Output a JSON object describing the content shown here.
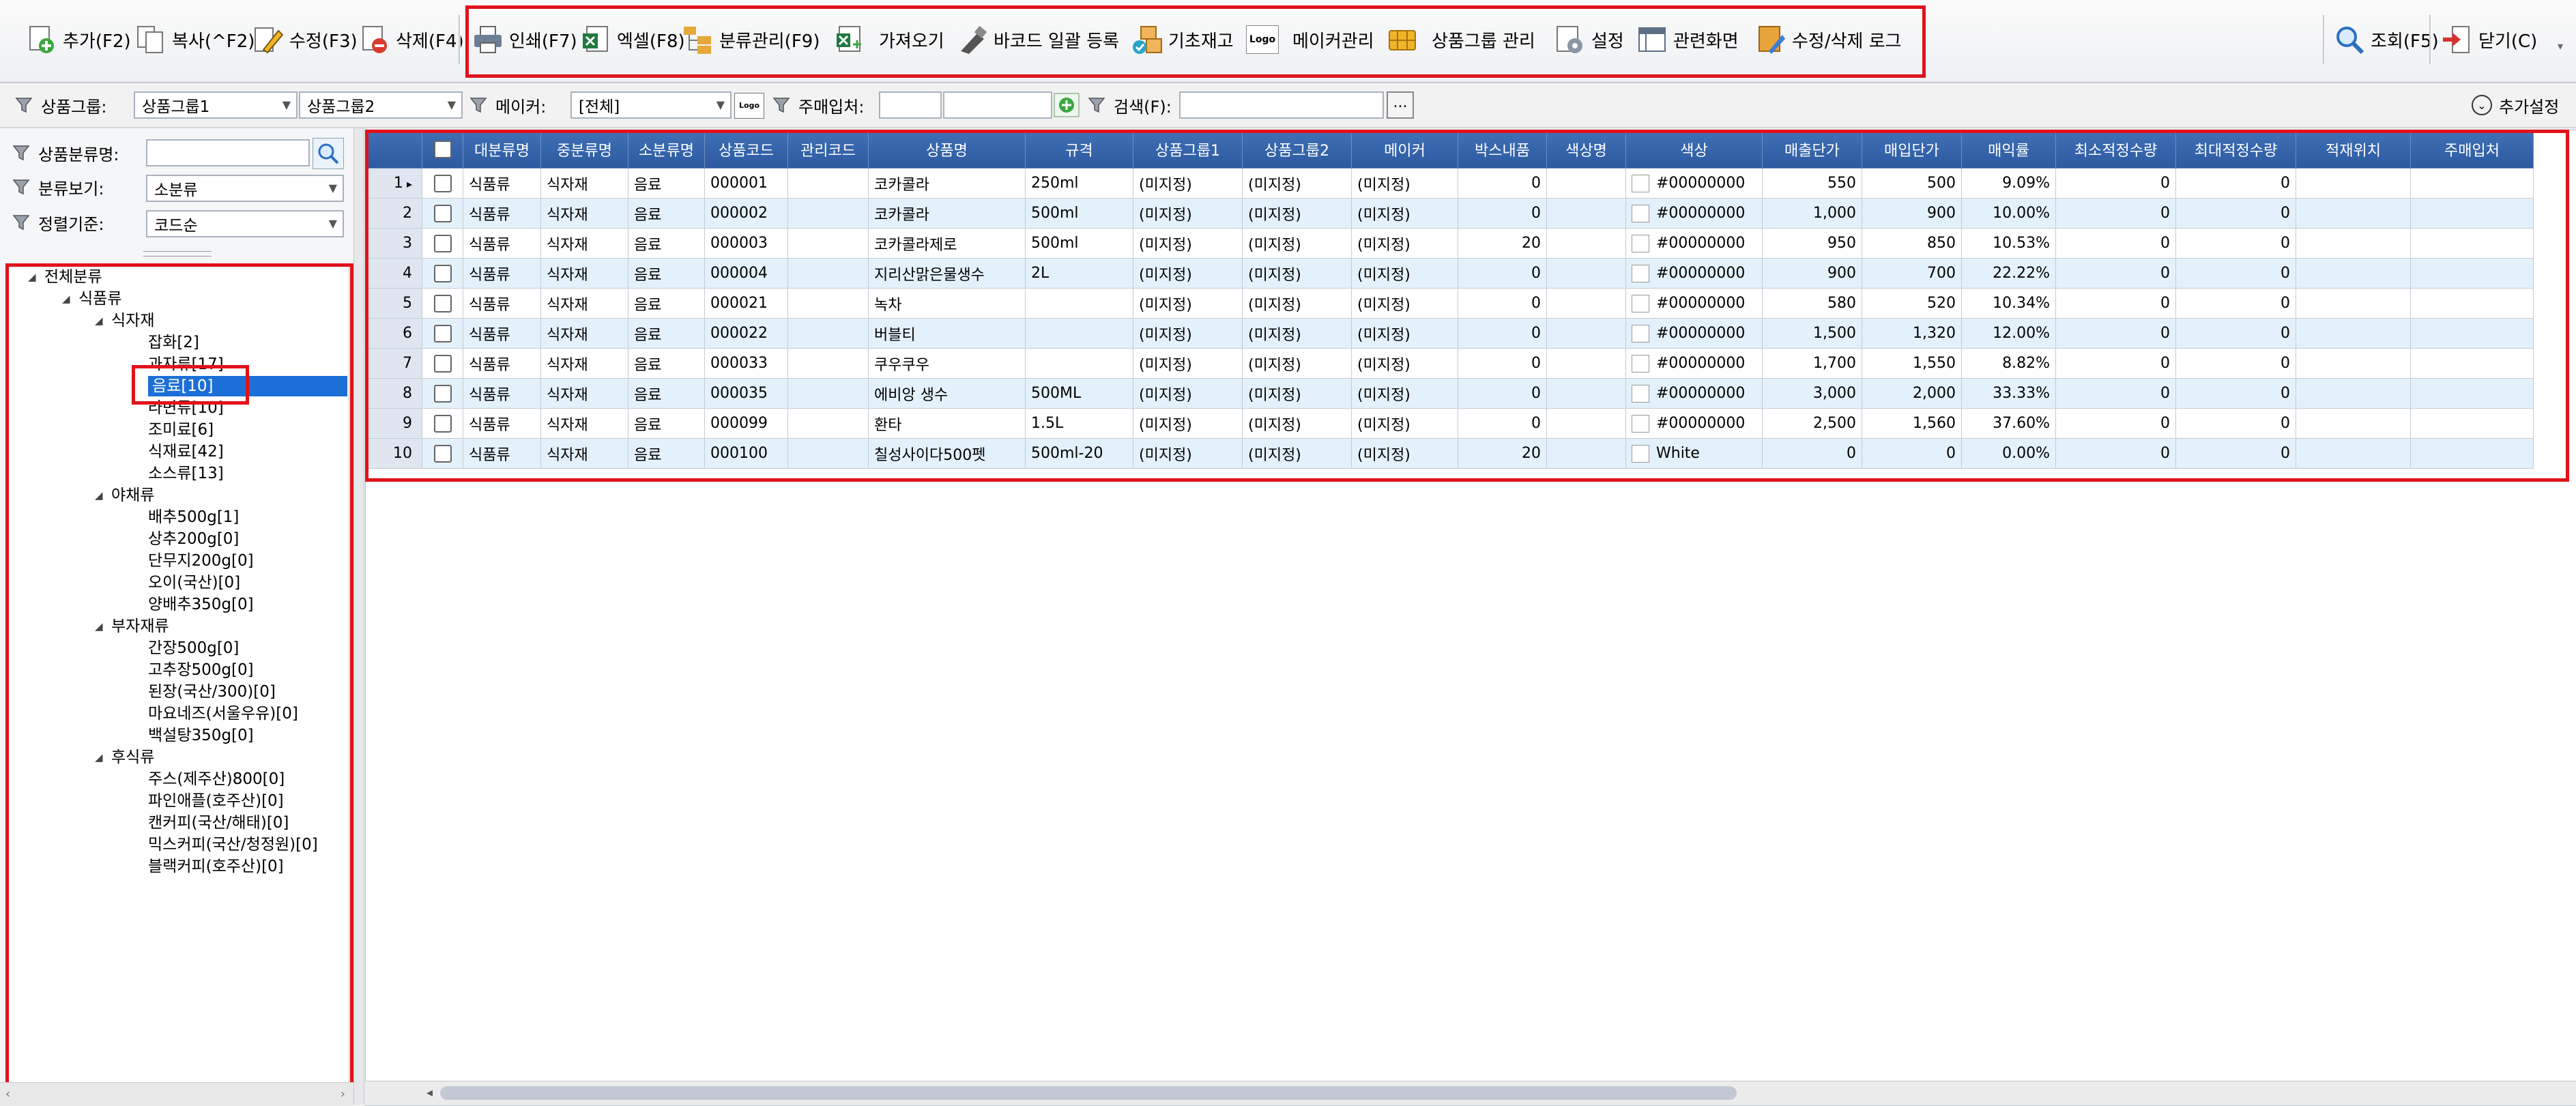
{
  "toolbar": {
    "add": "추가(F2)",
    "copy": "복사(^F2)",
    "edit": "수정(F3)",
    "delete": "삭제(F4)",
    "print": "인쇄(F7)",
    "excel": "엑셀(F8)",
    "category_mgmt": "분류관리(F9)",
    "import": "가져오기",
    "barcode": "바코드 일괄 등록",
    "base_stock": "기초재고",
    "maker_logo": "Logo",
    "maker_mgmt": "메이커관리",
    "group_mgmt": "상품그룹 관리",
    "settings": "설정",
    "related": "관련화면",
    "log": "수정/삭제 로그",
    "search": "조회(F5)",
    "close": "닫기(C)"
  },
  "filterbar": {
    "group_label": "상품그룹:",
    "group1": "상품그룹1",
    "group2": "상품그룹2",
    "maker_label": "메이커:",
    "maker_value": "[전체]",
    "maker_logo": "Logo",
    "supplier_label": "주매입처:",
    "search_label": "검색(F):",
    "browse": "...",
    "more": "추가설정"
  },
  "leftpanel": {
    "category_name_label": "상품분류명:",
    "view_label": "분류보기:",
    "view_value": "소분류",
    "sort_label": "정렬기준:",
    "sort_value": "코드순"
  },
  "tree": {
    "root": "전체분류",
    "food": "식품류",
    "ingredients": "식자재",
    "items_ingredients": [
      "잡화[2]",
      "과자류[17]",
      "음료[10]",
      "라면류[10]",
      "조미료[6]",
      "식재료[42]",
      "소스류[13]"
    ],
    "vegetables": "야채류",
    "items_vegetables": [
      "배추500g[1]",
      "상추200g[0]",
      "단무지200g[0]",
      "오이(국산)[0]",
      "양배추350g[0]"
    ],
    "subsidiary": "부자재류",
    "items_subsidiary": [
      "간장500g[0]",
      "고추장500g[0]",
      "된장(국산/300)[0]",
      "마요네즈(서울우유)[0]",
      "백설탕350g[0]"
    ],
    "dessert": "후식류",
    "items_dessert": [
      "주스(제주산)800[0]",
      "파인애플(호주산)[0]",
      "캔커피(국산/해태)[0]",
      "믹스커피(국산/청정원)[0]",
      "블랙커피(호주산)[0]"
    ]
  },
  "grid": {
    "columns": [
      "대분류명",
      "중분류명",
      "소분류명",
      "상품코드",
      "관리코드",
      "상품명",
      "규격",
      "상품그룹1",
      "상품그룹2",
      "메이커",
      "박스내품",
      "색상명",
      "색상",
      "매출단가",
      "매입단가",
      "매익률",
      "최소적정수량",
      "최대적정수량",
      "적재위치",
      "주매입처"
    ],
    "rows": [
      [
        "1",
        "식품류",
        "식자재",
        "음료",
        "000001",
        "",
        "코카콜라",
        "250ml",
        "(미지정)",
        "(미지정)",
        "(미지정)",
        "0",
        "",
        "#00000000",
        "550",
        "500",
        "9.09%",
        "0",
        "0",
        "",
        ""
      ],
      [
        "2",
        "식품류",
        "식자재",
        "음료",
        "000002",
        "",
        "코카콜라",
        "500ml",
        "(미지정)",
        "(미지정)",
        "(미지정)",
        "0",
        "",
        "#00000000",
        "1,000",
        "900",
        "10.00%",
        "0",
        "0",
        "",
        ""
      ],
      [
        "3",
        "식품류",
        "식자재",
        "음료",
        "000003",
        "",
        "코카콜라제로",
        "500ml",
        "(미지정)",
        "(미지정)",
        "(미지정)",
        "20",
        "",
        "#00000000",
        "950",
        "850",
        "10.53%",
        "0",
        "0",
        "",
        ""
      ],
      [
        "4",
        "식품류",
        "식자재",
        "음료",
        "000004",
        "",
        "지리산맑은물생수",
        "2L",
        "(미지정)",
        "(미지정)",
        "(미지정)",
        "0",
        "",
        "#00000000",
        "900",
        "700",
        "22.22%",
        "0",
        "0",
        "",
        ""
      ],
      [
        "5",
        "식품류",
        "식자재",
        "음료",
        "000021",
        "",
        "녹차",
        "",
        "(미지정)",
        "(미지정)",
        "(미지정)",
        "0",
        "",
        "#00000000",
        "580",
        "520",
        "10.34%",
        "0",
        "0",
        "",
        ""
      ],
      [
        "6",
        "식품류",
        "식자재",
        "음료",
        "000022",
        "",
        "버블티",
        "",
        "(미지정)",
        "(미지정)",
        "(미지정)",
        "0",
        "",
        "#00000000",
        "1,500",
        "1,320",
        "12.00%",
        "0",
        "0",
        "",
        ""
      ],
      [
        "7",
        "식품류",
        "식자재",
        "음료",
        "000033",
        "",
        "쿠우쿠우",
        "",
        "(미지정)",
        "(미지정)",
        "(미지정)",
        "0",
        "",
        "#00000000",
        "1,700",
        "1,550",
        "8.82%",
        "0",
        "0",
        "",
        ""
      ],
      [
        "8",
        "식품류",
        "식자재",
        "음료",
        "000035",
        "",
        "에비앙 생수",
        "500ML",
        "(미지정)",
        "(미지정)",
        "(미지정)",
        "0",
        "",
        "#00000000",
        "3,000",
        "2,000",
        "33.33%",
        "0",
        "0",
        "",
        ""
      ],
      [
        "9",
        "식품류",
        "식자재",
        "음료",
        "000099",
        "",
        "환타",
        "1.5L",
        "(미지정)",
        "(미지정)",
        "(미지정)",
        "0",
        "",
        "#00000000",
        "2,500",
        "1,560",
        "37.60%",
        "0",
        "0",
        "",
        ""
      ],
      [
        "10",
        "식품류",
        "식자재",
        "음료",
        "000100",
        "",
        "칠성사이다500펫",
        "500ml-20",
        "(미지정)",
        "(미지정)",
        "(미지정)",
        "20",
        "",
        "White",
        "0",
        "0",
        "0.00%",
        "0",
        "0",
        "",
        ""
      ]
    ]
  },
  "colors": {
    "header": "#2c5aa0",
    "row_alt": "#e3f1fb",
    "highlight": "#e1121c",
    "selected": "#1c6fd6"
  }
}
